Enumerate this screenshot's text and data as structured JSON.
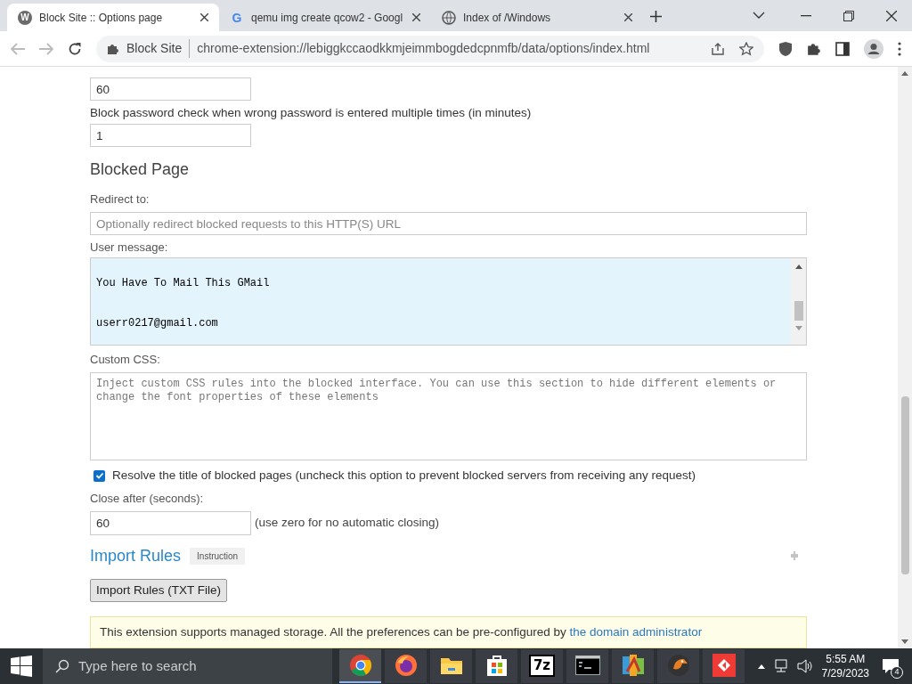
{
  "tabs": [
    {
      "title": "Block Site :: Options page",
      "icon": "W",
      "selected": true
    },
    {
      "title": "qemu img create qcow2 - Googl",
      "icon": "G",
      "selected": false
    },
    {
      "title": "Index of /Windows",
      "selected": false
    }
  ],
  "address_bar": {
    "site_label": "Block Site",
    "url": "chrome-extension://lebiggkccaodkkmjeimmbogdedcpnmfb/data/options/index.html"
  },
  "page": {
    "fields": [
      {
        "value": "60"
      },
      {
        "label": "Block password check when wrong password is entered multiple times (in minutes)",
        "value": "1"
      }
    ],
    "blocked_page": {
      "heading": "Blocked Page",
      "redirect_label": "Redirect to:",
      "redirect_placeholder": "Optionally redirect blocked requests to this HTTP(S) URL",
      "message_label": "User message:",
      "message_lines": [
        "You Have To Mail This GMail",
        "userr0217@gmail.com"
      ],
      "css_label": "Custom CSS:",
      "css_placeholder": "Inject custom CSS rules into the blocked interface. You can use this section to hide different elements or change the font properties of these elements",
      "resolve": {
        "label": "Resolve the title of blocked pages (uncheck this option to prevent blocked servers from receiving any request)",
        "checked": true
      },
      "close_label": "Close after (seconds):",
      "close_value": "60",
      "close_hint": "(use zero for no automatic closing)"
    },
    "import": {
      "heading": "Import Rules",
      "badge": "Instruction",
      "button": "Import Rules (TXT File)"
    },
    "notice": {
      "text": "This extension supports managed storage. All the preferences can be pre-configured by ",
      "link": "the domain administrator"
    }
  },
  "taskbar": {
    "search_placeholder": "Type here to search",
    "apps": [
      {
        "kind": "chrome",
        "selected": true
      },
      {
        "kind": "firefox",
        "selected": false
      },
      {
        "kind": "folder",
        "selected": false
      },
      {
        "kind": "store",
        "selected": false
      },
      {
        "kind": "sevenzip",
        "label": "7z",
        "selected": false
      },
      {
        "kind": "terminal",
        "selected": false
      },
      {
        "kind": "tiles",
        "selected": false
      },
      {
        "kind": "bird",
        "selected": false
      },
      {
        "kind": "remote",
        "selected": false
      }
    ],
    "time": "5:55 AM",
    "date": "7/29/2023",
    "notifications": "4"
  }
}
